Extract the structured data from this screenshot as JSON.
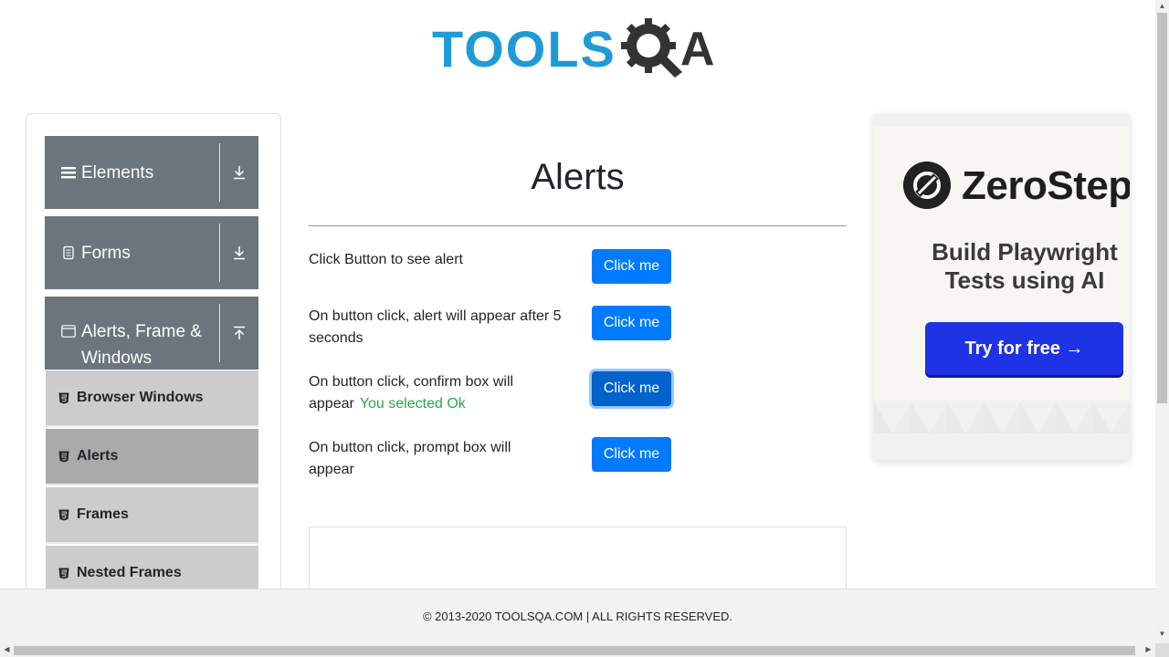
{
  "header": {
    "logo_text": "TOOLS",
    "logo_suffix": "A",
    "logo_icon": "gear-magnifier-icon"
  },
  "sidebar": {
    "groups": [
      {
        "label": "Elements",
        "icon": "hamburger-icon",
        "toggle_icon": "download-arrow-icon"
      },
      {
        "label": "Forms",
        "icon": "document-icon",
        "toggle_icon": "download-arrow-icon"
      },
      {
        "label": "Alerts, Frame & Windows",
        "icon": "window-icon",
        "toggle_icon": "upload-arrow-icon"
      }
    ],
    "items": [
      {
        "label": "Browser Windows",
        "icon": "html5-icon",
        "active": false
      },
      {
        "label": "Alerts",
        "icon": "html5-icon",
        "active": true
      },
      {
        "label": "Frames",
        "icon": "html5-icon",
        "active": false
      },
      {
        "label": "Nested Frames",
        "icon": "html5-icon",
        "active": false
      }
    ]
  },
  "main": {
    "title": "Alerts",
    "rows": [
      {
        "text": "Click Button to see alert",
        "button": "Click me",
        "result": ""
      },
      {
        "text": "On button click, alert will appear after 5 seconds",
        "button": "Click me",
        "result": ""
      },
      {
        "text": "On button click, confirm box will appear",
        "button": "Click me",
        "result": "You selected Ok"
      },
      {
        "text": "On button click, prompt box will appear",
        "button": "Click me",
        "result": ""
      }
    ]
  },
  "ad": {
    "brand": "ZeroStep",
    "headline": "Build Playwright Tests using AI",
    "cta": "Try for free →"
  },
  "footer": {
    "text": "© 2013-2020 TOOLSQA.COM | ALL RIGHTS RESERVED."
  },
  "colors": {
    "primary": "#007bff",
    "sidebar_group": "#6c757d",
    "menu_item": "#cccccc",
    "menu_active": "#aaaaaa",
    "success": "#28a745",
    "logo_blue": "#1e9bd7",
    "cta_blue": "#1f33e6"
  }
}
